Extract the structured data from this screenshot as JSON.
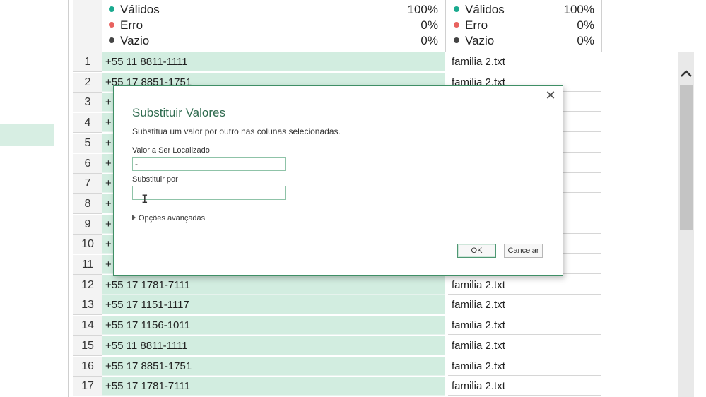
{
  "quality": {
    "col1": [
      {
        "label": "Válidos",
        "pct": "100%",
        "color": "#1aaa8f"
      },
      {
        "label": "Erro",
        "pct": "0%",
        "color": "#e8625f"
      },
      {
        "label": "Vazio",
        "pct": "0%",
        "color": "#444444"
      }
    ],
    "col2": [
      {
        "label": "Válidos",
        "pct": "100%",
        "color": "#1aaa8f"
      },
      {
        "label": "Erro",
        "pct": "0%",
        "color": "#e8625f"
      },
      {
        "label": "Vazio",
        "pct": "0%",
        "color": "#444444"
      }
    ]
  },
  "rows": [
    {
      "n": "1",
      "phone": "+55 11 8811-1111",
      "source": "familia 2.txt"
    },
    {
      "n": "2",
      "phone": "+55 17 8851-1751",
      "source": "familia 2.txt"
    },
    {
      "n": "3",
      "phone": "+",
      "source": ""
    },
    {
      "n": "4",
      "phone": "+",
      "source": ""
    },
    {
      "n": "5",
      "phone": "+",
      "source": ""
    },
    {
      "n": "6",
      "phone": "+",
      "source": ""
    },
    {
      "n": "7",
      "phone": "+",
      "source": ""
    },
    {
      "n": "8",
      "phone": "+",
      "source": ""
    },
    {
      "n": "9",
      "phone": "+",
      "source": ""
    },
    {
      "n": "10",
      "phone": "+",
      "source": ""
    },
    {
      "n": "11",
      "phone": "+",
      "source": ""
    },
    {
      "n": "12",
      "phone": "+55 17 1781-7111",
      "source": "familia 2.txt"
    },
    {
      "n": "13",
      "phone": "+55 17 1151-1117",
      "source": "familia 2.txt"
    },
    {
      "n": "14",
      "phone": "+55 17 1156-1011",
      "source": "familia 2.txt"
    },
    {
      "n": "15",
      "phone": "+55 11 8811-1111",
      "source": "familia 2.txt"
    },
    {
      "n": "16",
      "phone": "+55 17 8851-1751",
      "source": "familia 2.txt"
    },
    {
      "n": "17",
      "phone": "+55 17 1781-7111",
      "source": "familia 2.txt"
    }
  ],
  "dialog": {
    "close_glyph": "✕",
    "title": "Substituir Valores",
    "description": "Substitua um valor por outro nas colunas selecionadas.",
    "find_label": "Valor a Ser Localizado",
    "find_value": "-",
    "replace_label": "Substituir por",
    "replace_value": "",
    "advanced_label": "Opções avançadas",
    "ok_label": "OK",
    "cancel_label": "Cancelar"
  },
  "colors": {
    "selected_column": "#d2ede0",
    "accent": "#2f6b4f"
  }
}
